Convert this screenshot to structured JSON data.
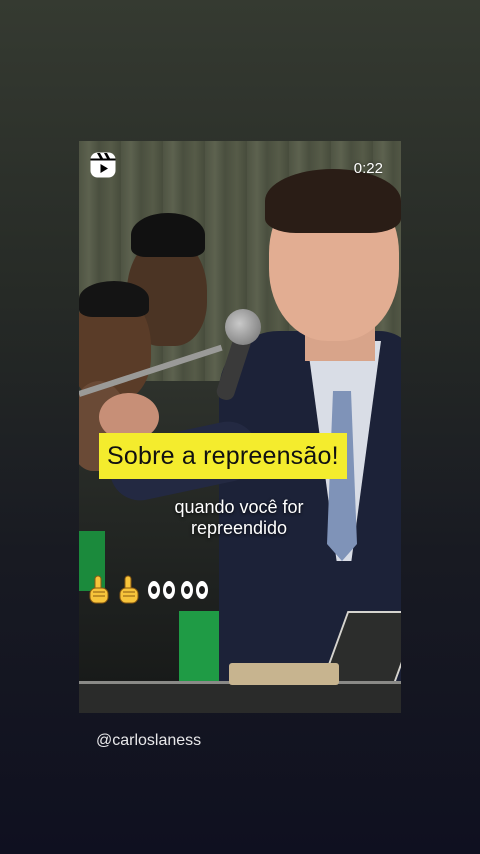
{
  "video": {
    "duration": "0:22",
    "caption_title": "Sobre a repreensão!",
    "caption_sub_line1": "quando você for",
    "caption_sub_line2": "repreendido",
    "emoji_text": "☝️☝️👀👀"
  },
  "author": {
    "handle": "@carloslaness"
  },
  "icons": {
    "reels": "reels-icon",
    "finger": "index-pointing-up-icon",
    "eyes": "eyes-icon"
  },
  "colors": {
    "caption_bg": "#f4ec2d",
    "caption_text": "#111111",
    "overlay_text": "#ffffff"
  }
}
